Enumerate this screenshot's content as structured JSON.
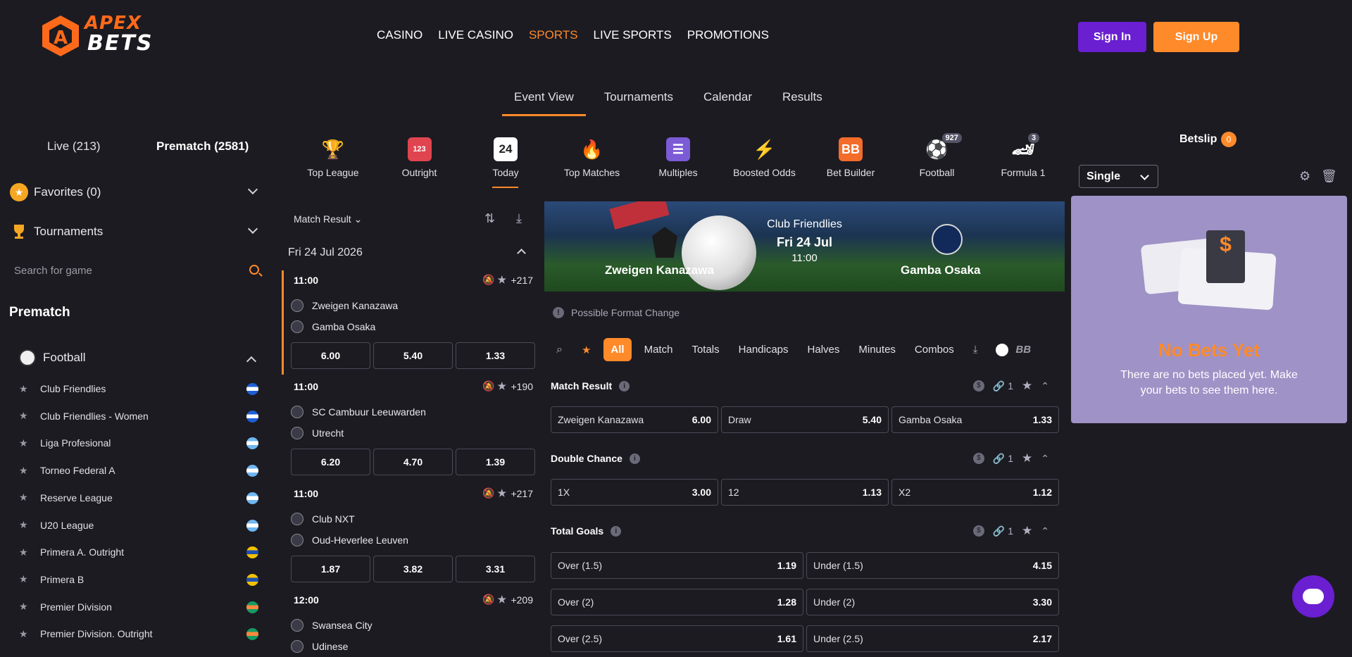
{
  "brand": {
    "line1": "APEX",
    "line2": "BETS",
    "accent": "#ff8a2a",
    "purple": "#6a1fd1"
  },
  "nav": [
    "CASINO",
    "LIVE CASINO",
    "SPORTS",
    "LIVE SPORTS",
    "PROMOTIONS"
  ],
  "auth": {
    "signin": "Sign In",
    "signup": "Sign Up"
  },
  "subtabs": [
    "Event View",
    "Tournaments",
    "Calendar",
    "Results"
  ],
  "left": {
    "live": "Live (213)",
    "prematch": "Prematch (2581)",
    "favorites": "Favorites (0)",
    "tournaments": "Tournaments",
    "search_placeholder": "Search for game",
    "section": "Prematch",
    "sport": "Football",
    "leagues": [
      "Club Friendlies",
      "Club Friendlies - Women",
      "Liga Profesional",
      "Torneo Federal A",
      "Reserve League",
      "U20 League",
      "Primera A. Outright",
      "Primera B",
      "Premier Division",
      "Premier Division. Outright"
    ]
  },
  "categories": [
    {
      "label": "Top League",
      "icon": "trophy-icon"
    },
    {
      "label": "Outright",
      "icon": "podium-icon"
    },
    {
      "label": "Today",
      "icon": "calendar-icon",
      "num": "24"
    },
    {
      "label": "Top Matches",
      "icon": "fire-icon"
    },
    {
      "label": "Multiples",
      "icon": "receipt-icon"
    },
    {
      "label": "Boosted Odds",
      "icon": "bolt-icon"
    },
    {
      "label": "Bet Builder",
      "icon": "bb-icon",
      "num": "BB"
    },
    {
      "label": "Football",
      "icon": "football-icon",
      "badge": "927"
    },
    {
      "label": "Formula 1",
      "icon": "racecar-icon",
      "badge": "3"
    }
  ],
  "list": {
    "market": "Match Result",
    "date": "Fri 24 Jul 2026",
    "matches": [
      {
        "time": "11:00",
        "more": "+217",
        "home": "Zweigen Kanazawa",
        "away": "Gamba Osaka",
        "odds": [
          "6.00",
          "5.40",
          "1.33"
        ]
      },
      {
        "time": "11:00",
        "more": "+190",
        "home": "SC Cambuur Leeuwarden",
        "away": "Utrecht",
        "odds": [
          "6.20",
          "4.70",
          "1.39"
        ]
      },
      {
        "time": "11:00",
        "more": "+217",
        "home": "Club NXT",
        "away": "Oud-Heverlee Leuven",
        "odds": [
          "1.87",
          "3.82",
          "3.31"
        ]
      },
      {
        "time": "12:00",
        "more": "+209",
        "home": "Swansea City",
        "away": "Udinese"
      }
    ]
  },
  "event": {
    "competition": "Club Friendlies",
    "date": "Fri 24 Jul",
    "time": "11:00",
    "home": "Zweigen Kanazawa",
    "away": "Gamba Osaka",
    "notice": "Possible Format Change",
    "filters": [
      "All",
      "Match",
      "Totals",
      "Handicaps",
      "Halves",
      "Minutes",
      "Combos"
    ],
    "bb": "BB",
    "markets": [
      {
        "name": "Match Result",
        "count": "1",
        "sels": [
          [
            "Zweigen Kanazawa",
            "6.00"
          ],
          [
            "Draw",
            "5.40"
          ],
          [
            "Gamba Osaka",
            "1.33"
          ]
        ]
      },
      {
        "name": "Double Chance",
        "count": "1",
        "sels": [
          [
            "1X",
            "3.00"
          ],
          [
            "12",
            "1.13"
          ],
          [
            "X2",
            "1.12"
          ]
        ]
      },
      {
        "name": "Total Goals",
        "count": "1",
        "rows": [
          [
            [
              "Over (1.5)",
              "1.19"
            ],
            [
              "Under (1.5)",
              "4.15"
            ]
          ],
          [
            [
              "Over (2)",
              "1.28"
            ],
            [
              "Under (2)",
              "3.30"
            ]
          ],
          [
            [
              "Over (2.5)",
              "1.61"
            ],
            [
              "Under (2.5)",
              "2.17"
            ]
          ]
        ]
      }
    ]
  },
  "betslip": {
    "title": "Betslip",
    "count": "0",
    "mode": "Single",
    "empty_title": "No Bets Yet",
    "empty_text": "There are no bets placed yet. Make your bets to see them here."
  }
}
